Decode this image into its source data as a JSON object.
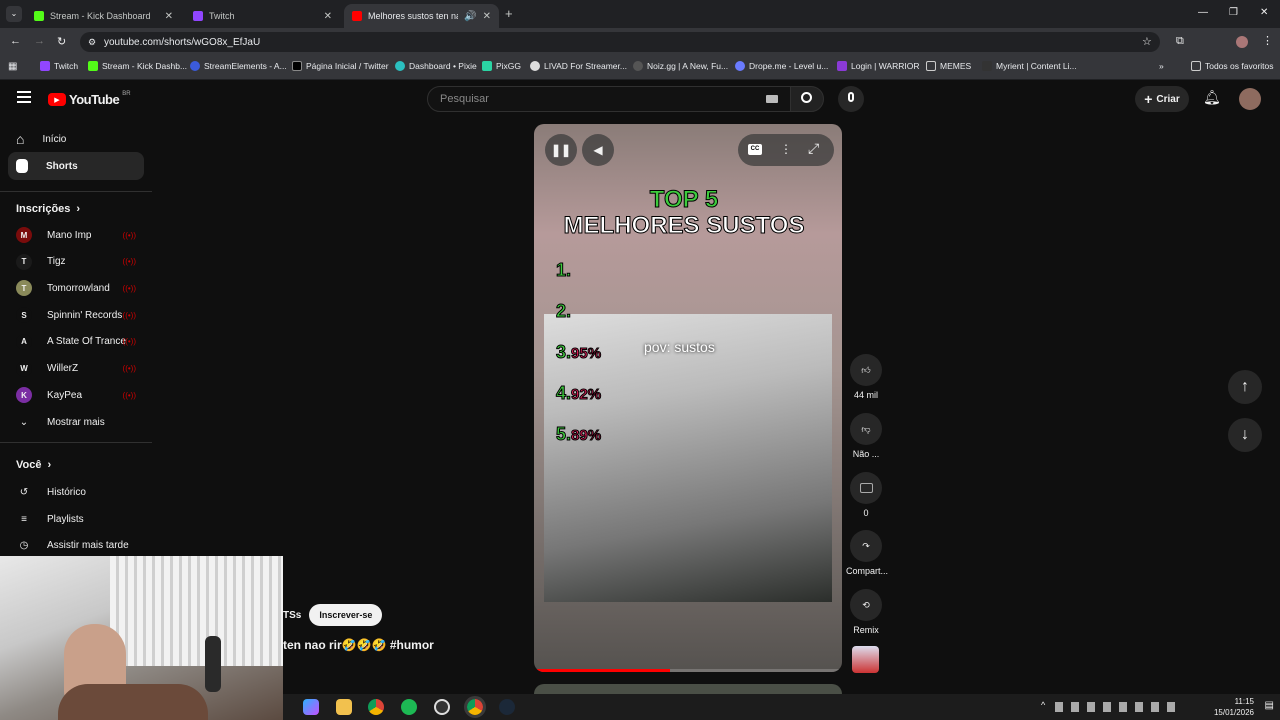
{
  "browser": {
    "tabs": [
      {
        "title": "Stream - Kick Dashboard",
        "color": "#53fc18"
      },
      {
        "title": "Twitch",
        "color": "#9146ff"
      },
      {
        "title": "Melhores sustos ten nao rir",
        "color": "#ff0000"
      }
    ],
    "url": "youtube.com/shorts/wGO8x_EfJaU",
    "bookmarks": [
      "Twitch",
      "Stream - Kick Dashb...",
      "StreamElements - A...",
      "Página Inicial / Twitter",
      "Dashboard • Pixie",
      "PixGG",
      "LIVAD For Streamer...",
      "Noiz.gg | A New, Fu...",
      "Drope.me - Level u...",
      "Login | WARRIOR",
      "MEMES",
      "Myrient | Content Li..."
    ],
    "all_bookmarks": "Todos os favoritos"
  },
  "youtube": {
    "logo_text": "YouTube",
    "region": "BR",
    "search_placeholder": "Pesquisar",
    "create_label": "Criar"
  },
  "sidebar": {
    "home": "Início",
    "shorts": "Shorts",
    "subscriptions_title": "Inscrições",
    "subscriptions": [
      {
        "name": "Mano Imp",
        "color": "#7a0c0c",
        "abbr": "M"
      },
      {
        "name": "Tigz",
        "color": "#1a1a1a",
        "abbr": "T"
      },
      {
        "name": "Tomorrowland",
        "color": "#8a8a5a",
        "abbr": "T"
      },
      {
        "name": "Spinnin' Records",
        "color": "#0f0f0f",
        "abbr": "S"
      },
      {
        "name": "A State Of Trance",
        "color": "#0f0f0f",
        "abbr": "A"
      },
      {
        "name": "WillerZ",
        "color": "#0f0f0f",
        "abbr": "W"
      },
      {
        "name": "KayPea",
        "color": "#7b2ea3",
        "abbr": "K"
      }
    ],
    "show_more": "Mostrar mais",
    "you_title": "Você",
    "history": "Histórico",
    "playlists": "Playlists",
    "watch_later": "Assistir mais tarde"
  },
  "video": {
    "title_line1": "TOP 5",
    "title_line2": "MELHORES SUSTOS",
    "ranks": [
      {
        "n": "1.",
        "pct": ""
      },
      {
        "n": "2.",
        "pct": ""
      },
      {
        "n": "3.",
        "pct": "95%"
      },
      {
        "n": "4.",
        "pct": "92%"
      },
      {
        "n": "5.",
        "pct": "89%"
      }
    ],
    "overlay_text": "pov: sustos",
    "progress": 0.44
  },
  "actions": {
    "likes": "44 mil",
    "dislike": "Não ...",
    "comments": "0",
    "share": "Compart...",
    "remix": "Remix"
  },
  "channel": {
    "name_suffix": "TSs",
    "subscribe": "Inscrever-se",
    "description": "ten nao rir🤣🤣🤣 #humor"
  },
  "taskbar": {
    "time": "11:15",
    "date": "15/01/2026"
  }
}
